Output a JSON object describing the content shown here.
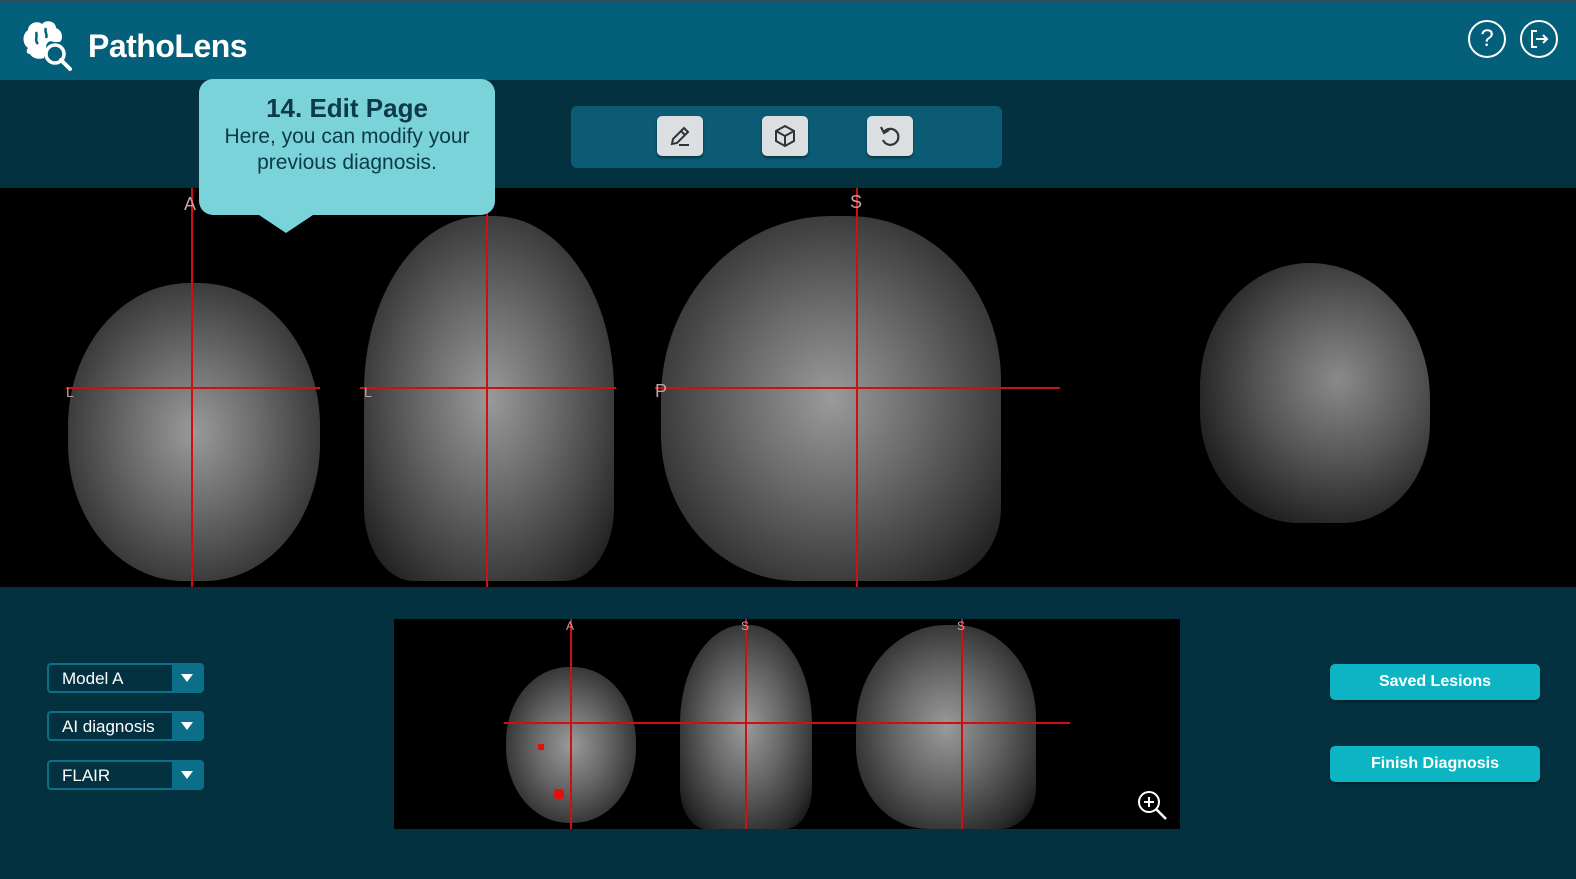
{
  "header": {
    "app_title": "PathoLens",
    "help_icon": "question-circle-icon",
    "logout_icon": "logout-icon",
    "logo_icon": "brain-search-icon"
  },
  "toolbar": {
    "tools": [
      {
        "name": "edit",
        "icon": "pencil-icon"
      },
      {
        "name": "3d-view",
        "icon": "cube-icon"
      },
      {
        "name": "undo",
        "icon": "undo-icon"
      }
    ]
  },
  "tooltip": {
    "title": "14. Edit Page",
    "body": "Here, you can modify your previous diagnosis."
  },
  "viewer": {
    "axial_label": "A",
    "coronal_label": "S",
    "sagittal_top_label": "S",
    "sagittal_left_label": "P",
    "axial_left_label": "L",
    "coronal_left_label": "L"
  },
  "mini_viewer": {
    "axial_label": "A",
    "coronal_label": "S",
    "sagittal_label": "S",
    "zoom_icon": "zoom-in-icon"
  },
  "controls": {
    "model_select": "Model A",
    "diagnosis_select": "AI diagnosis",
    "sequence_select": "FLAIR"
  },
  "actions": {
    "saved_lesions": "Saved Lesions",
    "finish_diagnosis": "Finish Diagnosis"
  },
  "colors": {
    "header_bg": "#04607a",
    "page_bg": "#04313f",
    "accent": "#0db5c4",
    "tooltip_bg": "#7ad3d8",
    "crosshair": "#d01010"
  }
}
